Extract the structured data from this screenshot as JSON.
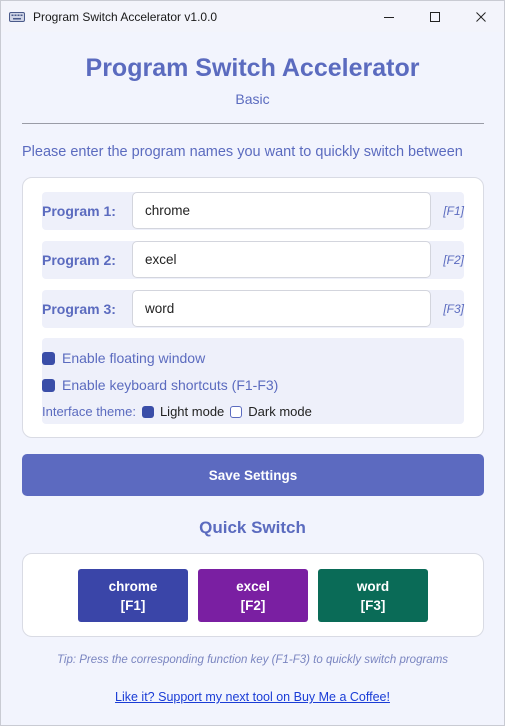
{
  "window": {
    "title": "Program Switch Accelerator v1.0.0",
    "app_icon": "keyboard-icon"
  },
  "header": {
    "title": "Program Switch Accelerator",
    "subtitle": "Basic"
  },
  "instruction": "Please enter the program names you want to quickly switch between",
  "programs": [
    {
      "label": "Program 1:",
      "value": "chrome",
      "key": "[F1]"
    },
    {
      "label": "Program 2:",
      "value": "excel",
      "key": "[F2]"
    },
    {
      "label": "Program 3:",
      "value": "word",
      "key": "[F3]"
    }
  ],
  "options": {
    "floating_window": {
      "label": "Enable floating window",
      "checked": true
    },
    "keyboard_shortcuts": {
      "label": "Enable keyboard shortcuts (F1-F3)",
      "checked": true
    },
    "theme": {
      "label": "Interface theme:",
      "light": "Light mode",
      "dark": "Dark mode",
      "selected": "Light mode"
    }
  },
  "save_label": "Save Settings",
  "quick_switch": {
    "title": "Quick Switch",
    "buttons": [
      {
        "name": "chrome",
        "key": "[F1]",
        "color": "#3a45a8"
      },
      {
        "name": "excel",
        "key": "[F2]",
        "color": "#7a1fa2"
      },
      {
        "name": "word",
        "key": "[F3]",
        "color": "#0a6b57"
      }
    ]
  },
  "tip": "Tip: Press the corresponding function key (F1-F3) to quickly switch programs",
  "support_link": "Like it? Support my next tool on Buy Me a Coffee!",
  "colors": {
    "accent": "#5b6bbf",
    "checkbox": "#3a4ea8",
    "background": "#f2f4fd"
  }
}
